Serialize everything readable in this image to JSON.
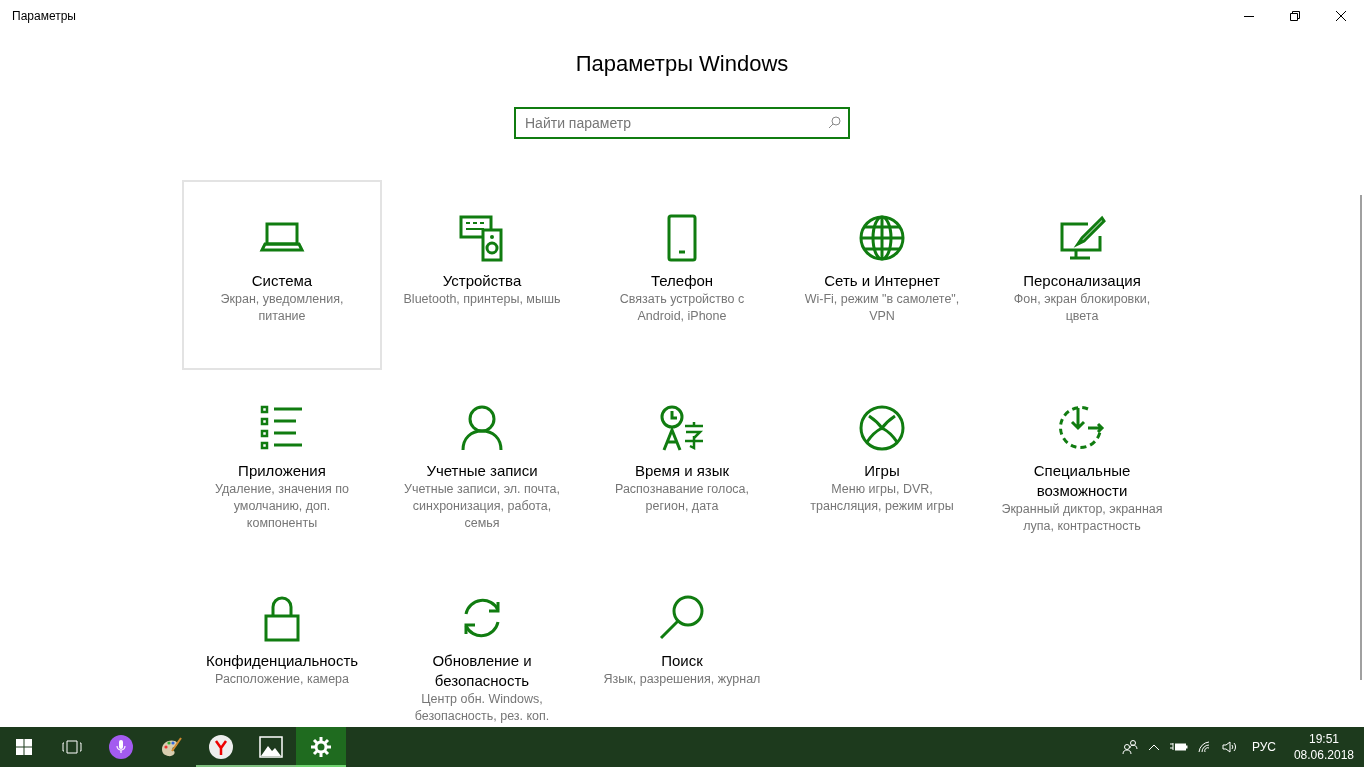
{
  "window": {
    "title": "Параметры"
  },
  "heading": "Параметры Windows",
  "search": {
    "placeholder": "Найти параметр"
  },
  "tiles": [
    {
      "title": "Система",
      "description": "Экран, уведомления, питание",
      "selected": true
    },
    {
      "title": "Устройства",
      "description": "Bluetooth, принтеры, мышь",
      "selected": false
    },
    {
      "title": "Телефон",
      "description": "Связать устройство с Android, iPhone",
      "selected": false
    },
    {
      "title": "Сеть и Интернет",
      "description": "Wi-Fi, режим \"в самолете\", VPN",
      "selected": false
    },
    {
      "title": "Персонализация",
      "description": "Фон, экран блокировки, цвета",
      "selected": false
    },
    {
      "title": "Приложения",
      "description": "Удаление, значения по умолчанию, доп. компоненты",
      "selected": false
    },
    {
      "title": "Учетные записи",
      "description": "Учетные записи, эл. почта, синхронизация, работа, семья",
      "selected": false
    },
    {
      "title": "Время и язык",
      "description": "Распознавание голоса, регион, дата",
      "selected": false
    },
    {
      "title": "Игры",
      "description": "Меню игры, DVR, трансляция, режим игры",
      "selected": false
    },
    {
      "title": "Специальные возможности",
      "description": "Экранный диктор, экранная лупа, контрастность",
      "selected": false
    },
    {
      "title": "Конфиденциальность",
      "description": "Расположение, камера",
      "selected": false
    },
    {
      "title": "Обновление и безопасность",
      "description": "Центр обн. Windows, безопасность, рез. коп.",
      "selected": false
    },
    {
      "title": "Поиск",
      "description": "Язык, разрешения, журнал",
      "selected": false
    }
  ],
  "taskbar": {
    "apps": [
      {
        "running": false,
        "active": false
      },
      {
        "running": false,
        "active": false
      },
      {
        "running": true,
        "active": false
      },
      {
        "running": true,
        "active": false
      },
      {
        "running": true,
        "active": true
      }
    ],
    "language": "РУС",
    "time": "19:51",
    "date": "08.06.2018"
  }
}
